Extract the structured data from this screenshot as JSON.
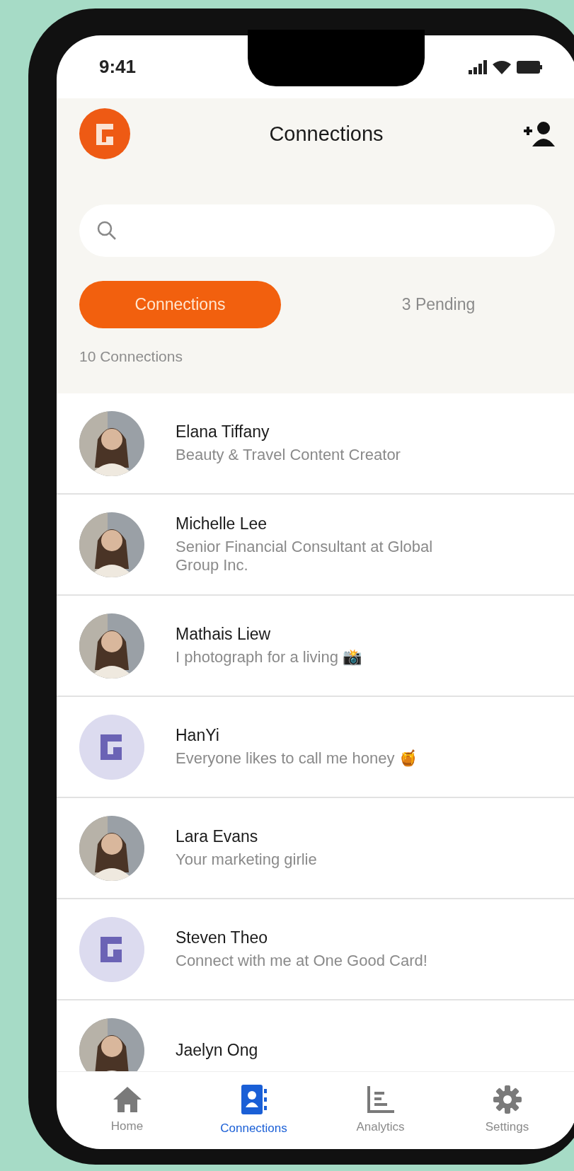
{
  "status_bar": {
    "time": "9:41"
  },
  "header": {
    "title": "Connections"
  },
  "tabs": [
    {
      "label": "Connections",
      "selected": true
    },
    {
      "label": "3 Pending",
      "selected": false
    }
  ],
  "count": "10 Connections",
  "connections": [
    {
      "name": "Elana Tiffany",
      "subtitle": "Beauty & Travel Content Creator"
    },
    {
      "name": "Michelle Lee",
      "subtitle": "Senior Financial Consultant at Global Group Inc."
    },
    {
      "name": "Mathais Liew",
      "subtitle": "I photograph for a living 📸"
    },
    {
      "name": "HanYi",
      "subtitle": "Everyone likes to call me honey 🍯",
      "avatar": {
        "kind": "logo"
      }
    },
    {
      "name": "Lara Evans",
      "subtitle": "Your marketing girlie"
    },
    {
      "name": "Steven Theo",
      "subtitle": "Connect with me at One Good Card!",
      "avatar": {
        "kind": "logo"
      }
    },
    {
      "name": "Jaelyn Ong"
    }
  ],
  "nav": [
    {
      "label": "Home",
      "kind": "home",
      "selected": false
    },
    {
      "label": "Connections",
      "kind": "contacts",
      "selected": true
    },
    {
      "label": "Analytics",
      "kind": "analytics",
      "selected": false
    },
    {
      "label": "Settings",
      "kind": "settings",
      "selected": false
    }
  ]
}
